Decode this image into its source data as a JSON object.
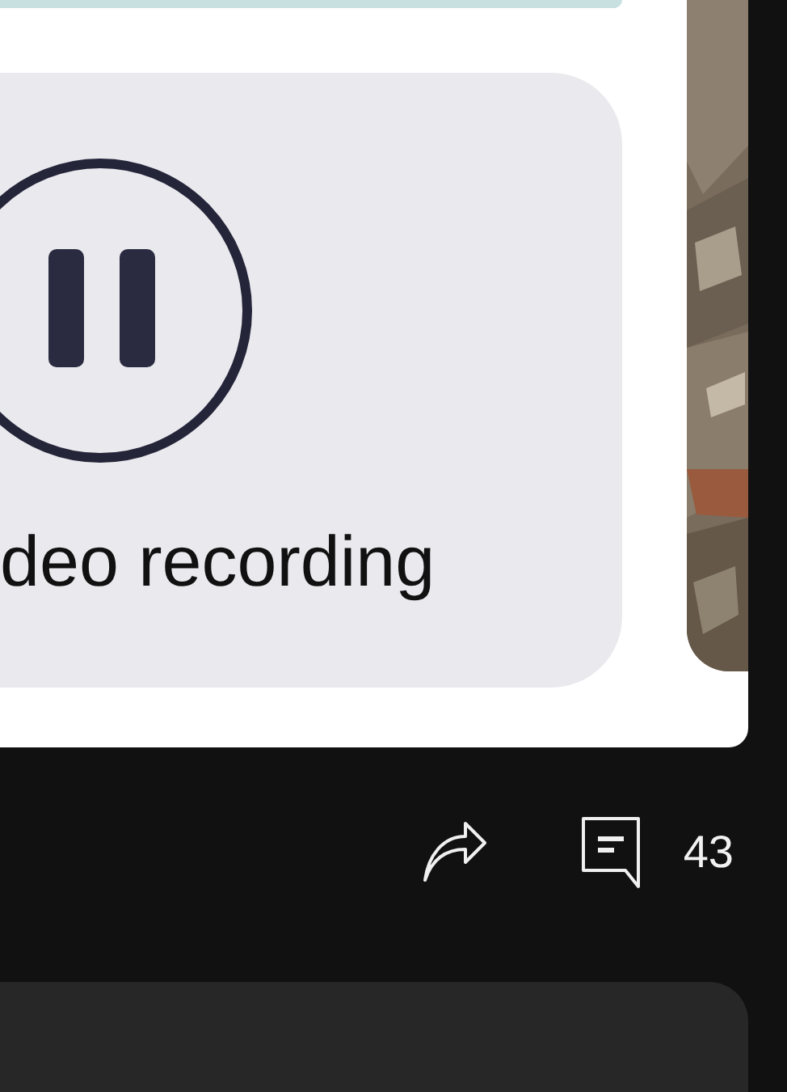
{
  "recording_card": {
    "caption": "deo recording",
    "paused": true
  },
  "actions": {
    "comment_count": "43"
  }
}
